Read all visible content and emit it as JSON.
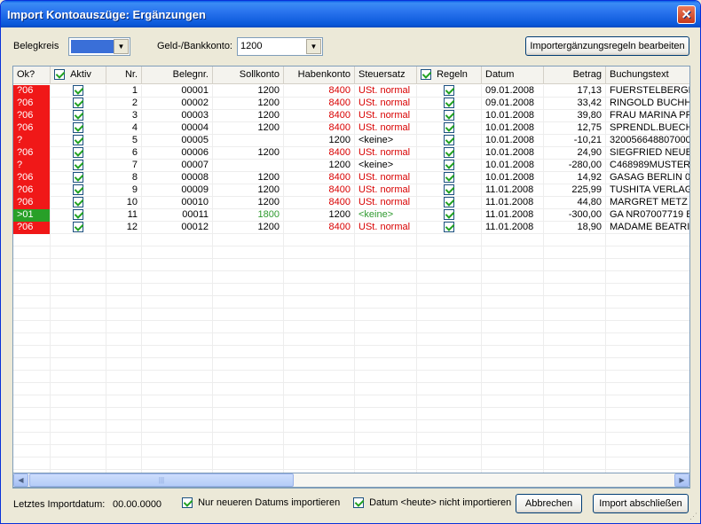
{
  "window": {
    "title": "Import Kontoauszüge: Ergänzungen",
    "close": "✕"
  },
  "toolbar": {
    "belegkreis_label": "Belegkreis",
    "belegkreis_color": "#3A6FD8",
    "bankkonto_label": "Geld-/Bankkonto:",
    "bankkonto_value": "1200",
    "edit_rules_label": "Importergänzungsregeln bearbeiten"
  },
  "columns": {
    "ok": "Ok?",
    "aktiv": "Aktiv",
    "nr": "Nr.",
    "belegnr": "Belegnr.",
    "sollkonto": "Sollkonto",
    "habenkonto": "Habenkonto",
    "steuersatz": "Steuersatz",
    "regeln": "Regeln",
    "datum": "Datum",
    "betrag": "Betrag",
    "buchungstext": "Buchungstext"
  },
  "rows": [
    {
      "ok": "?06",
      "ok_status": "red",
      "aktiv": true,
      "nr": "1",
      "belegnr": "00001",
      "soll": "1200",
      "soll_color": "black",
      "haben": "8400",
      "haben_color": "red",
      "steuer": "USt. normal",
      "steuer_color": "red",
      "regeln": true,
      "datum": "09.01.2008",
      "betrag": "17,13",
      "text": "FUERSTELBERGE"
    },
    {
      "ok": "?06",
      "ok_status": "red",
      "aktiv": true,
      "nr": "2",
      "belegnr": "00002",
      "soll": "1200",
      "soll_color": "black",
      "haben": "8400",
      "haben_color": "red",
      "steuer": "USt. normal",
      "steuer_color": "red",
      "regeln": true,
      "datum": "09.01.2008",
      "betrag": "33,42",
      "text": "RINGOLD BUCHH"
    },
    {
      "ok": "?06",
      "ok_status": "red",
      "aktiv": true,
      "nr": "3",
      "belegnr": "00003",
      "soll": "1200",
      "soll_color": "black",
      "haben": "8400",
      "haben_color": "red",
      "steuer": "USt. normal",
      "steuer_color": "red",
      "regeln": true,
      "datum": "10.01.2008",
      "betrag": "39,80",
      "text": "FRAU MARINA PF"
    },
    {
      "ok": "?06",
      "ok_status": "red",
      "aktiv": true,
      "nr": "4",
      "belegnr": "00004",
      "soll": "1200",
      "soll_color": "black",
      "haben": "8400",
      "haben_color": "red",
      "steuer": "USt. normal",
      "steuer_color": "red",
      "regeln": true,
      "datum": "10.01.2008",
      "betrag": "12,75",
      "text": "SPRENDL.BUECH"
    },
    {
      "ok": "?",
      "ok_status": "red",
      "aktiv": true,
      "nr": "5",
      "belegnr": "00005",
      "soll": "",
      "soll_color": "black",
      "haben": "1200",
      "haben_color": "black",
      "steuer": "<keine>",
      "steuer_color": "black",
      "regeln": true,
      "datum": "10.01.2008",
      "betrag": "-10,21",
      "text": "320056648807000"
    },
    {
      "ok": "?06",
      "ok_status": "red",
      "aktiv": true,
      "nr": "6",
      "belegnr": "00006",
      "soll": "1200",
      "soll_color": "black",
      "haben": "8400",
      "haben_color": "red",
      "steuer": "USt. normal",
      "steuer_color": "red",
      "regeln": true,
      "datum": "10.01.2008",
      "betrag": "24,90",
      "text": "SIEGFRIED NEUB"
    },
    {
      "ok": "?",
      "ok_status": "red",
      "aktiv": true,
      "nr": "7",
      "belegnr": "00007",
      "soll": "",
      "soll_color": "black",
      "haben": "1200",
      "haben_color": "black",
      "steuer": "<keine>",
      "steuer_color": "black",
      "regeln": true,
      "datum": "10.01.2008",
      "betrag": "-280,00",
      "text": "C468989MUSTER"
    },
    {
      "ok": "?06",
      "ok_status": "red",
      "aktiv": true,
      "nr": "8",
      "belegnr": "00008",
      "soll": "1200",
      "soll_color": "black",
      "haben": "8400",
      "haben_color": "red",
      "steuer": "USt. normal",
      "steuer_color": "red",
      "regeln": true,
      "datum": "10.01.2008",
      "betrag": "14,92",
      "text": "GASAG BERLIN 0("
    },
    {
      "ok": "?06",
      "ok_status": "red",
      "aktiv": true,
      "nr": "9",
      "belegnr": "00009",
      "soll": "1200",
      "soll_color": "black",
      "haben": "8400",
      "haben_color": "red",
      "steuer": "USt. normal",
      "steuer_color": "red",
      "regeln": true,
      "datum": "11.01.2008",
      "betrag": "225,99",
      "text": "TUSHITA VERLAG"
    },
    {
      "ok": "?06",
      "ok_status": "red",
      "aktiv": true,
      "nr": "10",
      "belegnr": "00010",
      "soll": "1200",
      "soll_color": "black",
      "haben": "8400",
      "haben_color": "red",
      "steuer": "USt. normal",
      "steuer_color": "red",
      "regeln": true,
      "datum": "11.01.2008",
      "betrag": "44,80",
      "text": "MARGRET METZ"
    },
    {
      "ok": ">01",
      "ok_status": "green",
      "aktiv": true,
      "nr": "11",
      "belegnr": "00011",
      "soll": "1800",
      "soll_color": "green",
      "haben": "1200",
      "haben_color": "black",
      "steuer": "<keine>",
      "steuer_color": "green",
      "regeln": true,
      "datum": "11.01.2008",
      "betrag": "-300,00",
      "text": "GA NR07007719 B"
    },
    {
      "ok": "?06",
      "ok_status": "red",
      "aktiv": true,
      "nr": "12",
      "belegnr": "00012",
      "soll": "1200",
      "soll_color": "black",
      "haben": "8400",
      "haben_color": "red",
      "steuer": "USt. normal",
      "steuer_color": "red",
      "regeln": true,
      "datum": "11.01.2008",
      "betrag": "18,90",
      "text": "MADAME BEATRI"
    }
  ],
  "scrollbar": {
    "left_arrow": "◀",
    "right_arrow": "▶",
    "thumb_grip": "|||"
  },
  "footer": {
    "last_import_label": "Letztes Importdatum:",
    "last_import_value": "00.00.0000",
    "newer_only_label": "Nur neueren Datums importieren",
    "newer_only_checked": true,
    "skip_today_label": "Datum <heute> nicht importieren",
    "skip_today_checked": true,
    "cancel_label": "Abbrechen",
    "finish_label": "Import abschließen"
  },
  "colors": {
    "ok_red": "#F01818",
    "ok_green": "#28A028",
    "text_red": "#D80000",
    "text_green": "#2E9A2E"
  }
}
